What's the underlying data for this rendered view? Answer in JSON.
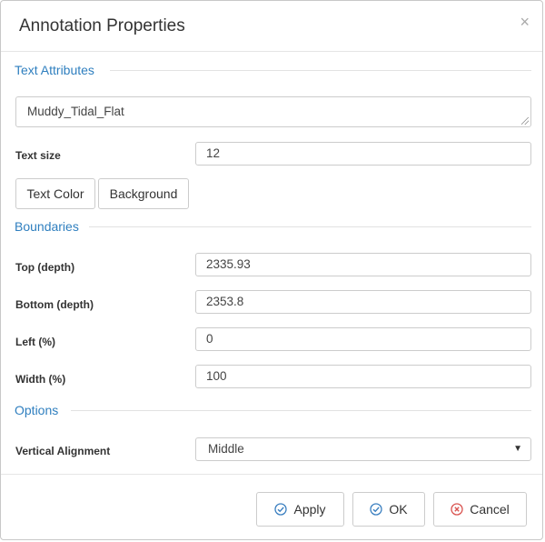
{
  "dialog": {
    "title": "Annotation Properties",
    "close_symbol": "×"
  },
  "text_attributes": {
    "legend": "Text Attributes",
    "text_value": "Muddy_Tidal_Flat",
    "text_size_label": "Text size",
    "text_size_value": "12",
    "text_color_button": "Text Color",
    "background_button": "Background"
  },
  "boundaries": {
    "legend": "Boundaries",
    "top_label": "Top (depth)",
    "top_value": "2335.93",
    "bottom_label": "Bottom (depth)",
    "bottom_value": "2353.8",
    "left_label": "Left (%)",
    "left_value": "0",
    "width_label": "Width (%)",
    "width_value": "100"
  },
  "options": {
    "legend": "Options",
    "vertical_alignment_label": "Vertical Alignment",
    "vertical_alignment_value": "Middle"
  },
  "footer": {
    "apply_label": "Apply",
    "ok_label": "OK",
    "cancel_label": "Cancel"
  },
  "icons": {
    "apply": "check-circle-icon",
    "ok": "check-circle-icon",
    "cancel": "x-circle-icon",
    "close": "close-icon",
    "dropdown": "chevron-down-icon"
  },
  "colors": {
    "section_legend": "#2f7fbf",
    "check_icon": "#3a7fc0",
    "cancel_icon": "#d9534f"
  }
}
